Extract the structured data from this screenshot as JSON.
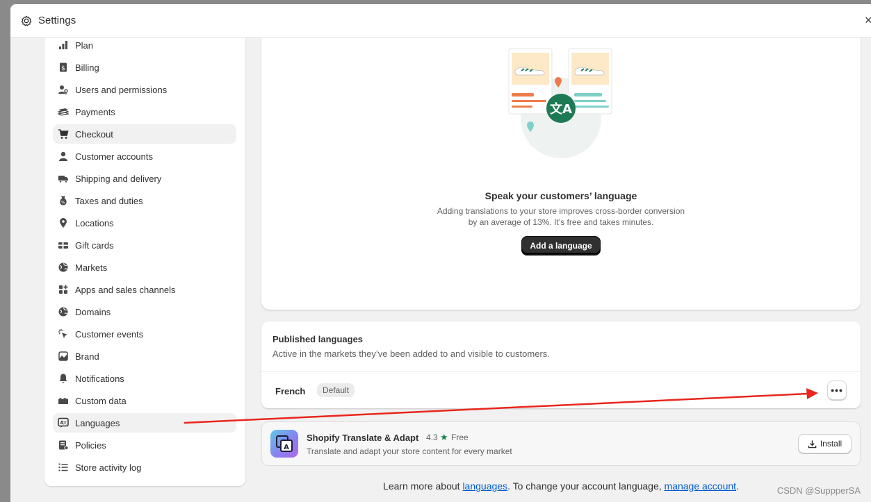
{
  "window": {
    "title": "Settings",
    "close_glyph": "×"
  },
  "sidebar": {
    "items": [
      {
        "label": "Plan",
        "icon": "plan-icon"
      },
      {
        "label": "Billing",
        "icon": "billing-icon"
      },
      {
        "label": "Users and permissions",
        "icon": "users-icon"
      },
      {
        "label": "Payments",
        "icon": "payments-icon"
      },
      {
        "label": "Checkout",
        "icon": "cart-icon"
      },
      {
        "label": "Customer accounts",
        "icon": "person-icon"
      },
      {
        "label": "Shipping and delivery",
        "icon": "truck-icon"
      },
      {
        "label": "Taxes and duties",
        "icon": "tax-icon"
      },
      {
        "label": "Locations",
        "icon": "location-pin-icon"
      },
      {
        "label": "Gift cards",
        "icon": "gift-card-icon"
      },
      {
        "label": "Markets",
        "icon": "globe-icon"
      },
      {
        "label": "Apps and sales channels",
        "icon": "apps-icon"
      },
      {
        "label": "Domains",
        "icon": "globe-icon"
      },
      {
        "label": "Customer events",
        "icon": "cursor-click-icon"
      },
      {
        "label": "Brand",
        "icon": "brand-icon"
      },
      {
        "label": "Notifications",
        "icon": "bell-icon"
      },
      {
        "label": "Custom data",
        "icon": "database-icon"
      },
      {
        "label": "Languages",
        "icon": "translate-icon"
      },
      {
        "label": "Policies",
        "icon": "policies-icon"
      },
      {
        "label": "Store activity log",
        "icon": "list-icon"
      }
    ]
  },
  "hero": {
    "title": "Speak your customers’ language",
    "line1": "Adding translations to your store improves cross-border conversion",
    "line2": "by an average of 13%. It’s free and takes minutes.",
    "button": "Add a language"
  },
  "published": {
    "title": "Published languages",
    "subtitle": "Active in the markets they’ve been added to and visible to customers.",
    "language": "French",
    "badge": "Default",
    "more": "•••"
  },
  "app": {
    "name": "Shopify Translate & Adapt",
    "rating": "4.3",
    "price": "Free",
    "description": "Translate and adapt your store content for every market",
    "install": "Install"
  },
  "footer": {
    "pre": "Learn more about ",
    "link1": "languages",
    "mid": ". To change your account language, ",
    "link2": "manage account",
    "post": "."
  },
  "watermark": "CSDN @SuppperSA",
  "colors": {
    "accent_green": "#1a7f4b",
    "link": "#005bd3",
    "annotation_arrow": "#e8261c"
  }
}
